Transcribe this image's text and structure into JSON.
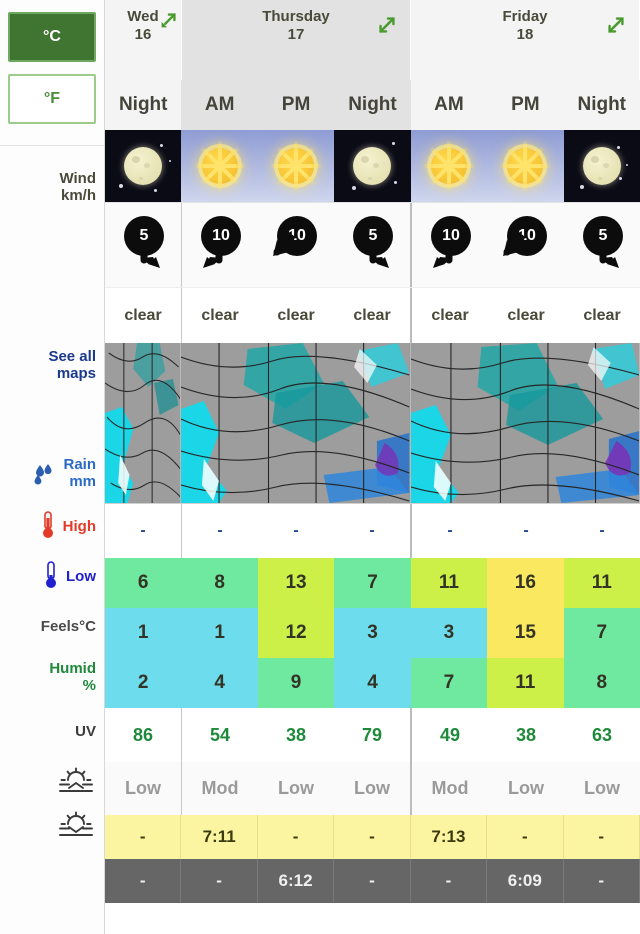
{
  "units": {
    "celsius_label": "°C",
    "fahrenheit_label": "°F",
    "active": "°C"
  },
  "labels": {
    "wind": "Wind\nkm/h",
    "wind_line1": "Wind",
    "wind_line2": "km/h",
    "see_all_maps_line1": "See all",
    "see_all_maps_line2": "maps",
    "rain_line1": "Rain",
    "rain_line2": "mm",
    "high": "High",
    "low": "Low",
    "feels": "Feels°C",
    "humid_line1": "Humid",
    "humid_line2": "%",
    "uv": "UV"
  },
  "days": [
    {
      "name": "Wed",
      "date": "16",
      "periods": 1,
      "shade": "light"
    },
    {
      "name": "Thursday",
      "date": "17",
      "periods": 3,
      "shade": "dim"
    },
    {
      "name": "Friday",
      "date": "18",
      "periods": 3,
      "shade": "light"
    }
  ],
  "columns": [
    {
      "period": "Night",
      "daypart": "night",
      "shade": "light",
      "sky_icon": "moon-icon",
      "wind_speed": "5",
      "wind_dir": "se",
      "condition": "clear",
      "rain": "-",
      "high": "6",
      "low": "1",
      "feels": "2",
      "humidity": "86",
      "uv": "Low",
      "sunrise": "-",
      "sunset": "-",
      "high_color": "#6fe8a0",
      "low_color": "#6ddcec",
      "feels_color": "#6ddcec"
    },
    {
      "period": "AM",
      "daypart": "day",
      "shade": "dim",
      "sky_icon": "sun-icon",
      "wind_speed": "10",
      "wind_dir": "sw",
      "condition": "clear",
      "rain": "-",
      "high": "8",
      "low": "1",
      "feels": "4",
      "humidity": "54",
      "uv": "Mod",
      "sunrise": "7:11",
      "sunset": "-",
      "high_color": "#6fe8a0",
      "low_color": "#6ddcec",
      "feels_color": "#6ddcec"
    },
    {
      "period": "PM",
      "daypart": "day",
      "shade": "dim",
      "sky_icon": "sun-icon",
      "wind_speed": "10",
      "wind_dir": "nw",
      "condition": "clear",
      "rain": "-",
      "high": "13",
      "low": "12",
      "feels": "9",
      "humidity": "38",
      "uv": "Low",
      "sunrise": "-",
      "sunset": "6:12",
      "high_color": "#cdf048",
      "low_color": "#cdf048",
      "feels_color": "#6fe8a0"
    },
    {
      "period": "Night",
      "daypart": "night",
      "shade": "dim",
      "sky_icon": "moon-icon",
      "wind_speed": "5",
      "wind_dir": "se",
      "condition": "clear",
      "rain": "-",
      "high": "7",
      "low": "3",
      "feels": "4",
      "humidity": "79",
      "uv": "Low",
      "sunrise": "-",
      "sunset": "-",
      "high_color": "#6fe8a0",
      "low_color": "#6ddcec",
      "feels_color": "#6ddcec"
    },
    {
      "period": "AM",
      "daypart": "day",
      "shade": "light",
      "sky_icon": "sun-icon",
      "wind_speed": "10",
      "wind_dir": "sw",
      "condition": "clear",
      "rain": "-",
      "high": "11",
      "low": "3",
      "feels": "7",
      "humidity": "49",
      "uv": "Mod",
      "sunrise": "7:13",
      "sunset": "-",
      "high_color": "#cdf048",
      "low_color": "#6ddcec",
      "feels_color": "#6fe8a0"
    },
    {
      "period": "PM",
      "daypart": "day",
      "shade": "light",
      "sky_icon": "sun-icon",
      "wind_speed": "10",
      "wind_dir": "nw",
      "condition": "clear",
      "rain": "-",
      "high": "16",
      "low": "15",
      "feels": "11",
      "humidity": "38",
      "uv": "Low",
      "sunrise": "-",
      "sunset": "6:09",
      "high_color": "#fae860",
      "low_color": "#fae860",
      "feels_color": "#cdf048"
    },
    {
      "period": "Night",
      "daypart": "night",
      "shade": "light",
      "sky_icon": "moon-icon",
      "wind_speed": "5",
      "wind_dir": "se",
      "condition": "clear",
      "rain": "-",
      "high": "11",
      "low": "7",
      "feels": "8",
      "humidity": "63",
      "uv": "Low",
      "sunrise": "-",
      "sunset": "-",
      "high_color": "#cdf048",
      "low_color": "#6fe8a0",
      "feels_color": "#6fe8a0"
    }
  ],
  "icons": {
    "expand": "expand-arrows-icon",
    "rain_drops": "rain-drops-icon",
    "thermometer_high": "thermometer-high-icon",
    "thermometer_low": "thermometer-low-icon",
    "sunrise": "sunrise-icon",
    "sunset": "sunset-icon"
  },
  "colors": {
    "accent_green": "#3f7431",
    "link_blue": "#1b3a8c",
    "high_red": "#e23b28",
    "low_blue": "#2020d0",
    "humid_green": "#1f8a3b",
    "sunrise_bg": "#fbf4a0",
    "sunset_bg": "#666666"
  }
}
